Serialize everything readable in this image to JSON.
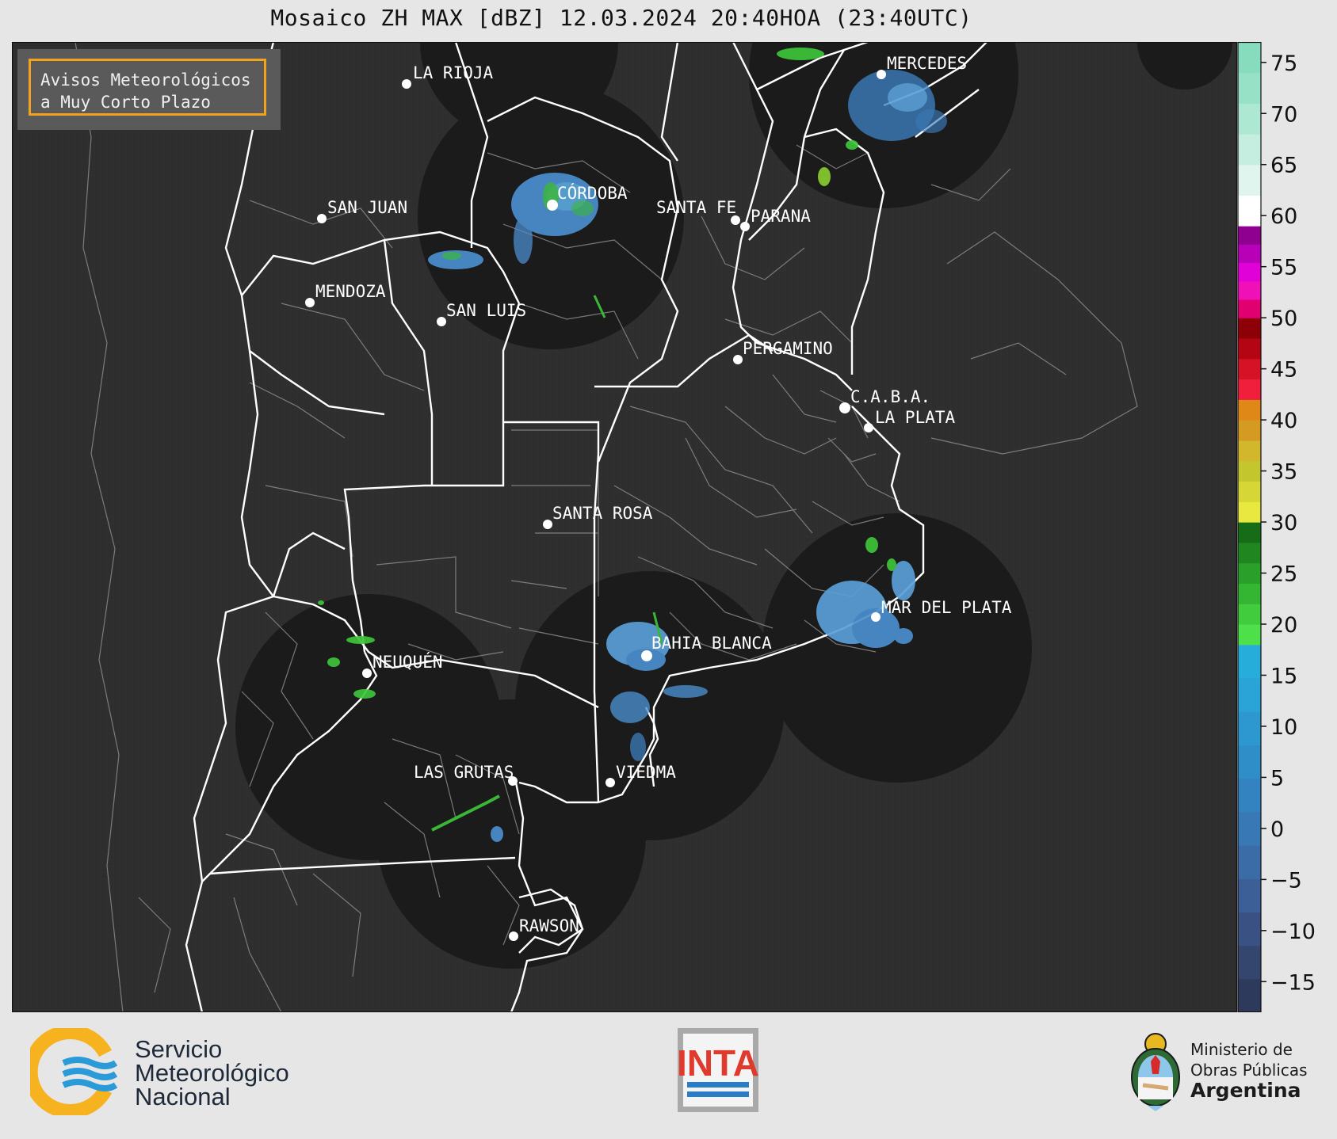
{
  "title": "Mosaico ZH MAX [dBZ] 12.03.2024 20:40HOA (23:40UTC)",
  "notice": {
    "line1": "Avisos Meteorológicos",
    "line2": "a Muy Corto Plazo",
    "border_color": "#f2a31b"
  },
  "cities": [
    {
      "name": "LA RIOJA"
    },
    {
      "name": "CÓRDOBA"
    },
    {
      "name": "SAN JUAN"
    },
    {
      "name": "SANTA FE"
    },
    {
      "name": "PARANA"
    },
    {
      "name": "MENDOZA"
    },
    {
      "name": "SAN LUIS"
    },
    {
      "name": "MERCEDES"
    },
    {
      "name": "PERGAMINO"
    },
    {
      "name": "C.A.B.A."
    },
    {
      "name": "LA PLATA"
    },
    {
      "name": "SANTA ROSA"
    },
    {
      "name": "MAR DEL PLATA"
    },
    {
      "name": "BAHIA BLANCA"
    },
    {
      "name": "NEUQUÉN"
    },
    {
      "name": "LAS GRUTAS"
    },
    {
      "name": "VIEDMA"
    },
    {
      "name": "RAWSON"
    }
  ],
  "colorbar": {
    "unit": "dBZ",
    "ticks": [
      "75",
      "70",
      "65",
      "60",
      "55",
      "50",
      "45",
      "40",
      "35",
      "30",
      "25",
      "20",
      "15",
      "10",
      "5",
      "0",
      "−5",
      "−10",
      "−15"
    ],
    "range": [
      -18,
      77
    ],
    "bands": [
      {
        "from": -18,
        "to": 18,
        "colors": [
          "#2e3a5c",
          "#34456e",
          "#3a5283",
          "#3d5f97",
          "#3c6ca7",
          "#3878b5",
          "#3383c0",
          "#2f8ec8",
          "#2c98cf",
          "#2aa3d6",
          "#27add9"
        ]
      },
      {
        "from": 18,
        "to": 30,
        "colors": [
          "#4ee04a",
          "#40cc3c",
          "#34b632",
          "#2a9f29",
          "#1f8620",
          "#166c17"
        ]
      },
      {
        "from": 30,
        "to": 42,
        "colors": [
          "#e8e840",
          "#d6d636",
          "#c4c62e",
          "#d2b62c",
          "#d49a22",
          "#df8818"
        ]
      },
      {
        "from": 42,
        "to": 50,
        "colors": [
          "#f0203c",
          "#d51226",
          "#b30514",
          "#8e0008"
        ]
      },
      {
        "from": 50,
        "to": 59,
        "colors": [
          "#e0006f",
          "#f010b8",
          "#e000d8",
          "#b800b8",
          "#900090"
        ]
      },
      {
        "from": 59,
        "to": 77,
        "colors": [
          "#ffffff",
          "#e0f5ee",
          "#c6eee0",
          "#ade8d2",
          "#97e2c6",
          "#86dcbc"
        ]
      }
    ]
  },
  "radar_echo_colors": {
    "weak": "#3d7fc0",
    "light": "#5aa0d8",
    "moderate": "#3ec63a"
  },
  "footer": {
    "smn_line1": "Servicio",
    "smn_line2": "Meteorológico",
    "smn_line3": "Nacional",
    "inta": "INTA",
    "mop_line1": "Ministerio de",
    "mop_line2": "Obras Públicas",
    "mop_line3": "Argentina"
  }
}
